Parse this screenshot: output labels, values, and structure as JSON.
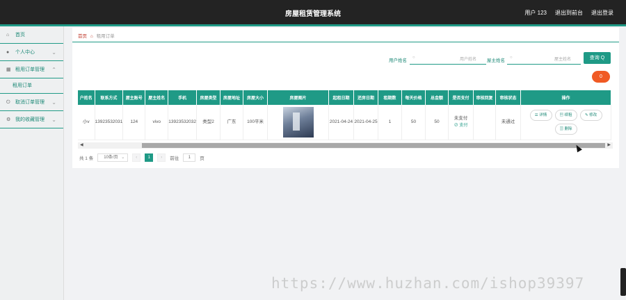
{
  "header": {
    "title": "房屋租赁管理系统",
    "user_label": "用户 123",
    "back_label": "退出到前台",
    "logout_label": "退出登录"
  },
  "sidebar": {
    "items": [
      {
        "label": "首页",
        "icon": "home-icon"
      },
      {
        "label": "个人中心",
        "icon": "user-icon"
      },
      {
        "label": "租用订单管理",
        "icon": "grid-icon"
      },
      {
        "label": "租用订单"
      },
      {
        "label": "取消订单管理",
        "icon": "power-icon"
      },
      {
        "label": "我的收藏管理",
        "icon": "gear-icon"
      }
    ]
  },
  "breadcrumb": {
    "home": "首页",
    "current": "租用订单"
  },
  "search": {
    "user_name_label": "用户姓名",
    "user_name_placeholder": "用户姓名",
    "owner_name_label": "屋主姓名",
    "owner_name_placeholder": "屋主姓名",
    "search_button": "查询 Q",
    "delete_badge": "0"
  },
  "table": {
    "headers": [
      "户姓名",
      "联系方式",
      "屋主账号",
      "屋主姓名",
      "手机",
      "房屋类型",
      "房屋地址",
      "房屋大小",
      "房屋图片",
      "起租日期",
      "还房日期",
      "租期数",
      "每天价格",
      "总金额",
      "是否支付",
      "审核回复",
      "审核状态",
      "操作"
    ],
    "row": {
      "user_name": "小v",
      "contact": "13923532031",
      "owner_account": "124",
      "owner_name": "vivo",
      "phone": "13923532032",
      "house_type": "类型2",
      "address": "广东",
      "size": "100平米",
      "start_date": "2021-04-24",
      "end_date": "2021-04-25",
      "term": "1",
      "daily_price": "50",
      "total": "50",
      "paid": "未支付",
      "pay_link": "支付",
      "reply": "",
      "status": "未通过"
    },
    "actions": {
      "detail": "详情",
      "rent": "续租",
      "edit": "修改",
      "delete": "删除"
    }
  },
  "pager": {
    "total": "共 1 条",
    "page_size": "10条/页",
    "current_page": "1",
    "goto_prefix": "前往",
    "goto_value": "1",
    "goto_suffix": "页"
  },
  "watermark": "https://www.huzhan.com/ishop39397",
  "colors": {
    "accent": "#1f9a86",
    "topbar": "#232323",
    "delete": "#f05a24"
  }
}
